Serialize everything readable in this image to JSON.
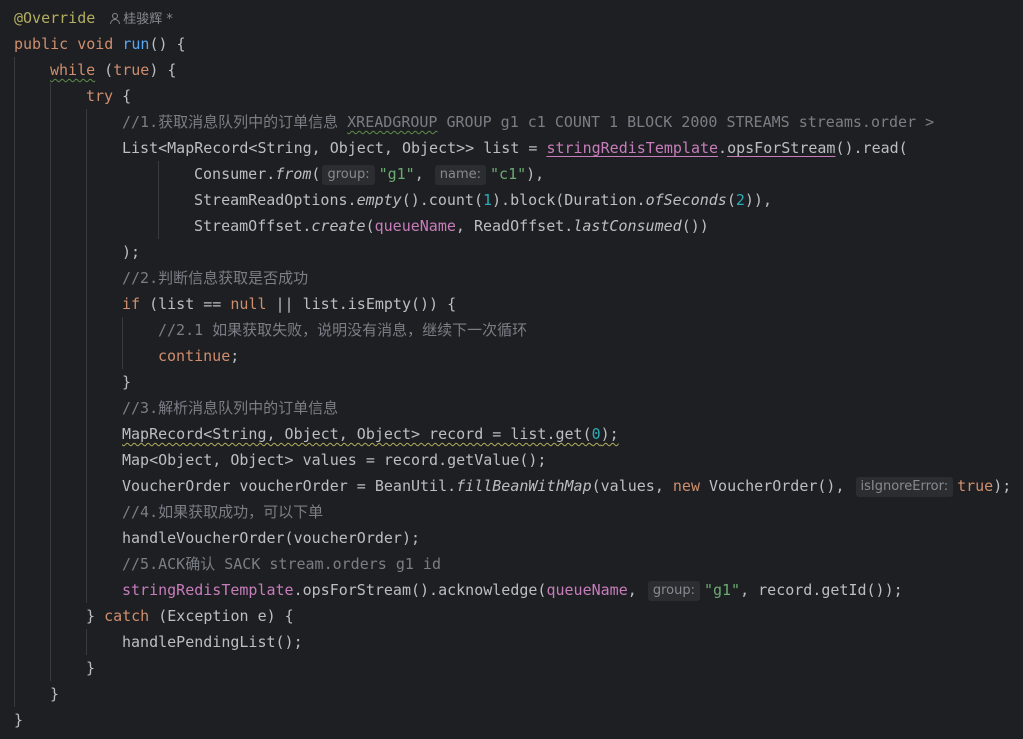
{
  "editor": {
    "author": "桂骏辉 *",
    "lines": {
      "l1": {
        "annotation": "@Override"
      },
      "l2": {
        "public": "public",
        "void": "void",
        "method": "run",
        "rest": "() {"
      },
      "l3": {
        "while": "while",
        "open": " (",
        "true": "true",
        "close": ") {"
      },
      "l4": {
        "try": "try",
        "rest": " {"
      },
      "l5": {
        "comment_a": "//1.获取消息队列中的订单信息 ",
        "comment_b": "XREADGROUP",
        "comment_c": " GROUP g1 c1 COUNT 1 BLOCK 2000 STREAMS streams.order >"
      },
      "l6": {
        "type": "List<MapRecord<String, Object, Object>> list = ",
        "field": "stringRedisTemplate",
        "dot": ".",
        "method": "opsForStream",
        "rest": "().read("
      },
      "l7": {
        "a": "Consumer.",
        "from": "from",
        "paren": "(",
        "hint": "group:",
        "str1": "\"g1\"",
        "comma": ", ",
        "hint2": "name:",
        "str2": "\"c1\"",
        "end": "),"
      },
      "l8": {
        "a": "StreamReadOptions.",
        "empty": "empty",
        "b": "().count(",
        "n1": "1",
        "c": ").block(Duration.",
        "ofSeconds": "ofSeconds",
        "d": "(",
        "n2": "2",
        "e": ")),"
      },
      "l9": {
        "a": "StreamOffset.",
        "create": "create",
        "b": "(",
        "queue": "queueName",
        "c": ", ReadOffset.",
        "last": "lastConsumed",
        "d": "())"
      },
      "l10": {
        "text": ");"
      },
      "l11": {
        "comment": "//2.判断信息获取是否成功"
      },
      "l12": {
        "if": "if",
        "a": " (list == ",
        "null": "null",
        "b": " || list.isEmpty()) {"
      },
      "l13": {
        "comment": "//2.1 如果获取失败，说明没有消息，继续下一次循环"
      },
      "l14": {
        "continue": "continue",
        "semi": ";"
      },
      "l15": {
        "text": "}"
      },
      "l16": {
        "comment": "//3.解析消息队列中的订单信息"
      },
      "l17": {
        "a": "MapRecord<String, Object, Object> record = list.get(",
        "n": "0",
        "b": ");"
      },
      "l18": {
        "text": "Map<Object, Object> values = record.getValue();"
      },
      "l19": {
        "a": "VoucherOrder voucherOrder = BeanUtil.",
        "fill": "fillBeanWithMap",
        "b": "(values, ",
        "new": "new",
        "c": " VoucherOrder(), ",
        "hint": "isIgnoreError:",
        "true": "true",
        "d": ");"
      },
      "l20": {
        "comment": "//4.如果获取成功，可以下单"
      },
      "l21": {
        "text": "handleVoucherOrder(voucherOrder);"
      },
      "l22": {
        "comment": "//5.ACK确认 SACK stream.orders g1 id"
      },
      "l23": {
        "field": "stringRedisTemplate",
        "a": ".opsForStream().acknowledge(",
        "queue": "queueName",
        "b": ", ",
        "hint": "group:",
        "str": "\"g1\"",
        "c": ", record.getId());"
      },
      "l24": {
        "a": "} ",
        "catch": "catch",
        "b": " (Exception e) {"
      },
      "l25": {
        "text": "handlePendingList();"
      },
      "l26": {
        "text": "}"
      },
      "l27": {
        "text": "}"
      },
      "l28": {
        "text": "}"
      }
    }
  }
}
